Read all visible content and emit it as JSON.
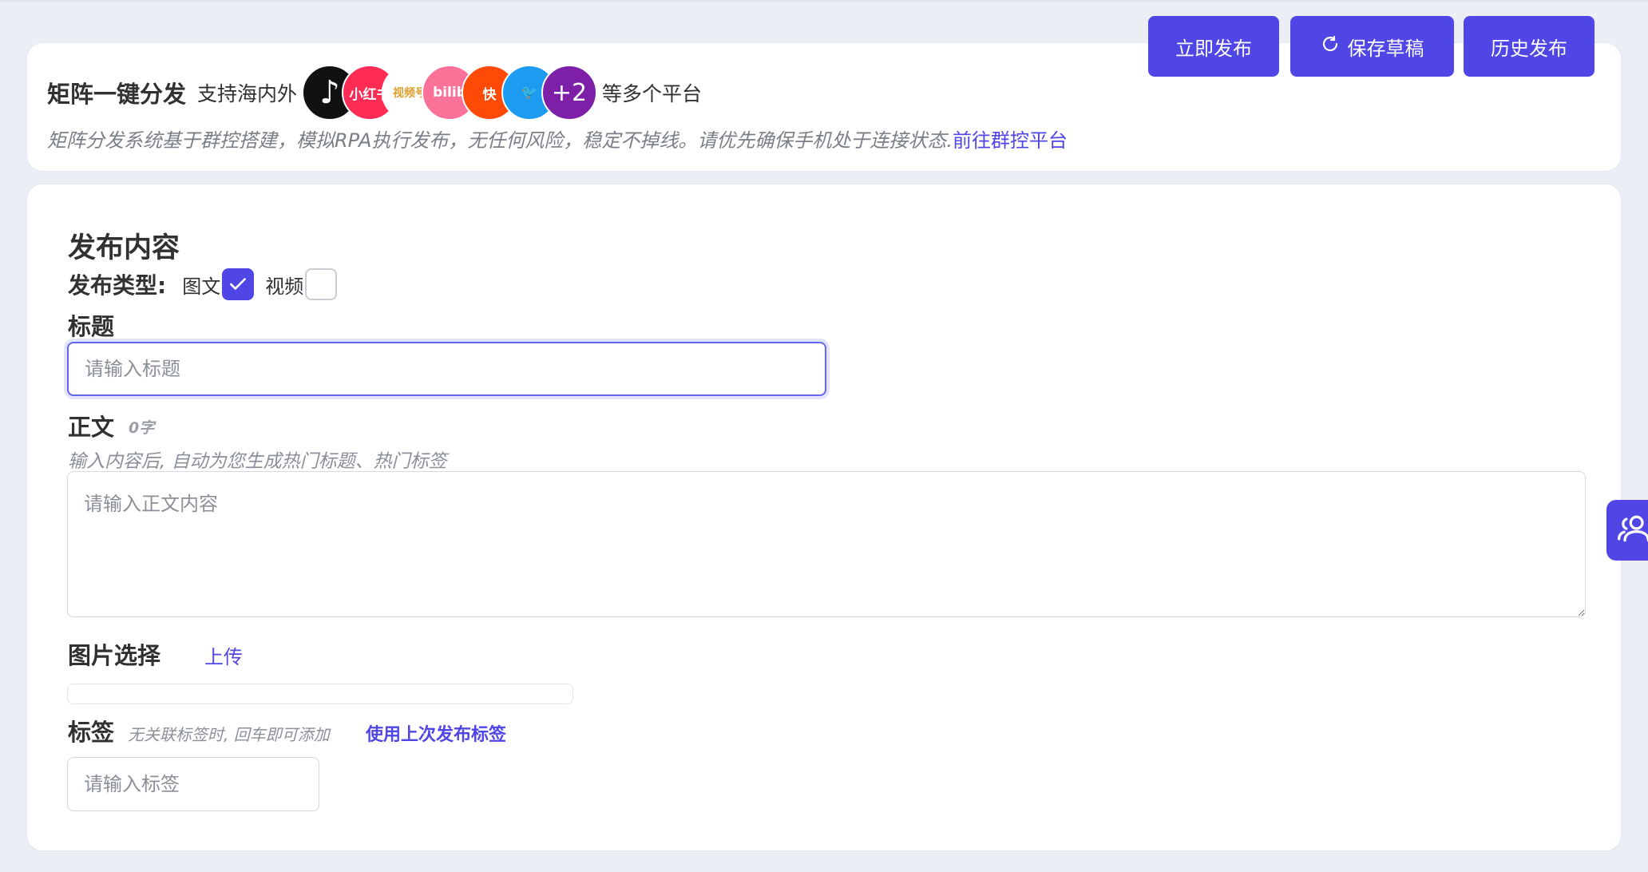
{
  "header": {
    "title": "矩阵一键分发",
    "support_text": "支持海内外",
    "platforms": [
      {
        "name": "抖音",
        "label": "♪",
        "color": "#111111"
      },
      {
        "name": "小红书",
        "label": "小红书",
        "color": "#fe2c55"
      },
      {
        "name": "视频号",
        "label": "视频号",
        "color": "#ffffff"
      },
      {
        "name": "bilibili",
        "label": "bilib",
        "color": "#fb7299"
      },
      {
        "name": "快手",
        "label": "快",
        "color": "#ff4906"
      },
      {
        "name": "Twitter",
        "label": "🐦",
        "color": "#1d9bf0"
      },
      {
        "name": "more",
        "label": "+2",
        "color": "#7e1fa8"
      }
    ],
    "more_text": "等多个平台",
    "description": "矩阵分发系统基于群控搭建，模拟RPA执行发布，无任何风险，稳定不掉线。请优先确保手机处于连接状态.",
    "link_text": "前往群控平台"
  },
  "actions": {
    "publish_now": "立即发布",
    "save_draft": "保存草稿",
    "history": "历史发布"
  },
  "content": {
    "section_title": "发布内容",
    "type_label": "发布类型:",
    "type_options": [
      {
        "label": "图文",
        "checked": true
      },
      {
        "label": "视频",
        "checked": false
      }
    ],
    "title_label": "标题",
    "title_placeholder": "请输入标题",
    "body_label": "正文",
    "body_count": "0字",
    "body_hint": "输入内容后, 自动为您生成热门标题、热门标签",
    "body_placeholder": "请输入正文内容",
    "image_label": "图片选择",
    "upload_label": "上传",
    "tags_label": "标签",
    "tags_hint": "无关联标签时, 回车即可添加",
    "use_last_tags": "使用上次发布标签",
    "tags_placeholder": "请输入标签"
  },
  "colors": {
    "accent": "#4f46e5",
    "background": "#ebeef5"
  }
}
